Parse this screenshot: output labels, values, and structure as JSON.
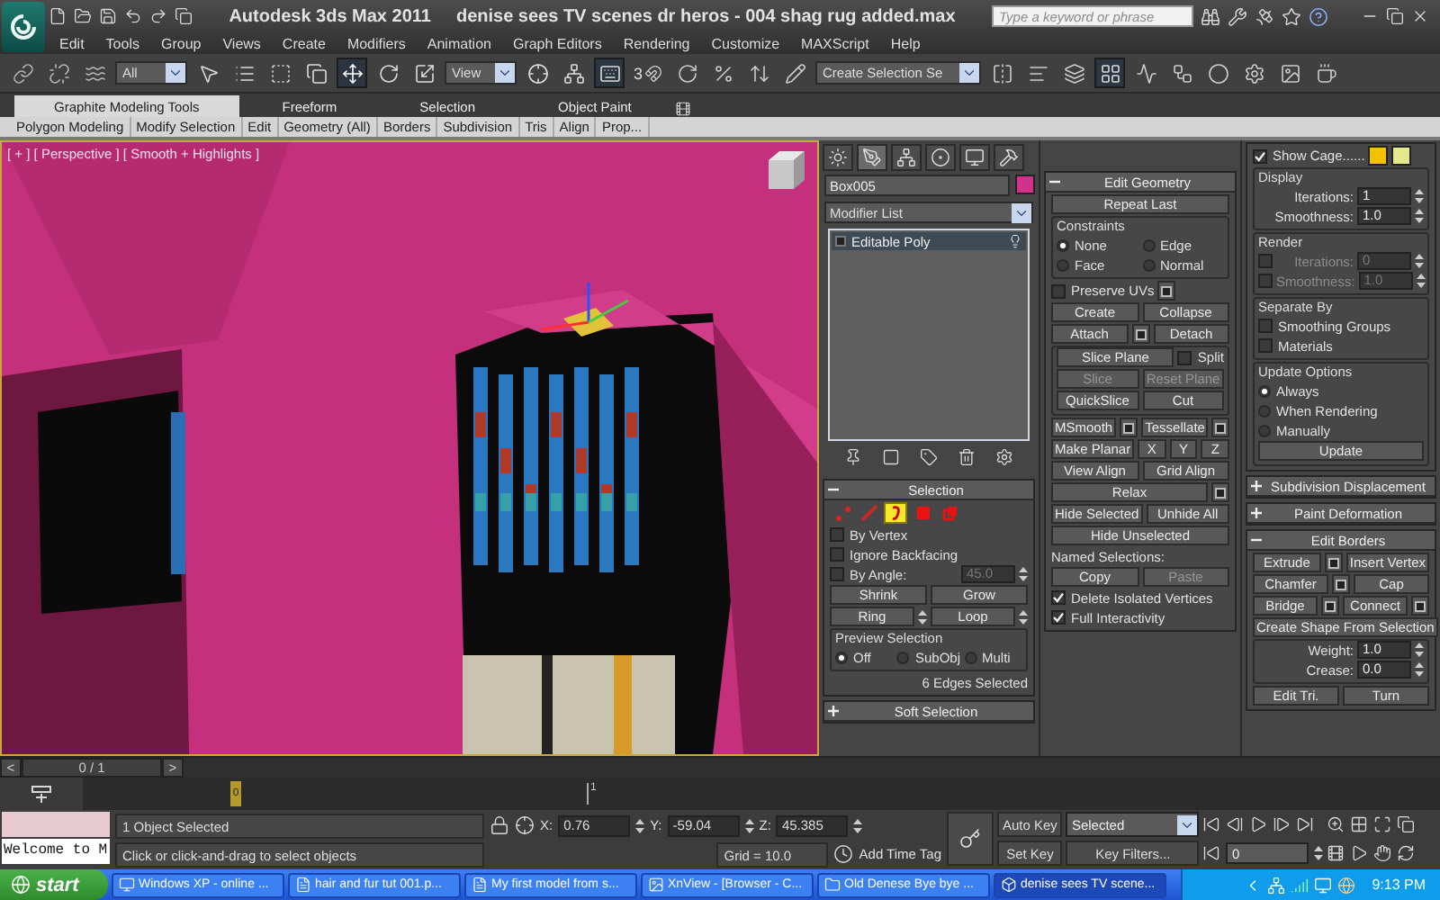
{
  "title_bar": {
    "app": "Autodesk 3ds Max  2011",
    "document": "denise sees TV scenes dr heros - 004 shag rug added.max",
    "search": {
      "placeholder": "Type a keyword or phrase"
    }
  },
  "menu": [
    "Edit",
    "Tools",
    "Group",
    "Views",
    "Create",
    "Modifiers",
    "Animation",
    "Graph Editors",
    "Rendering",
    "Customize",
    "MAXScript",
    "Help"
  ],
  "toolbar": {
    "items": [
      {
        "kind": "tool",
        "selected": false
      },
      {
        "kind": "tool",
        "selected": false
      },
      {
        "kind": "tool",
        "selected": false
      },
      {
        "kind": "dropdown",
        "value": "All"
      },
      {
        "kind": "tool",
        "selected": false
      },
      {
        "kind": "tool",
        "selected": false
      },
      {
        "kind": "tool",
        "selected": false
      },
      {
        "kind": "tool",
        "selected": false
      },
      {
        "kind": "tool",
        "selected": true
      },
      {
        "kind": "tool",
        "selected": false
      },
      {
        "kind": "tool",
        "selected": false
      },
      {
        "kind": "dropdown",
        "value": "View"
      },
      {
        "kind": "tool",
        "selected": false
      },
      {
        "kind": "tool",
        "selected": false
      },
      {
        "kind": "tool",
        "selected": true
      },
      {
        "kind": "snap",
        "value": "3"
      },
      {
        "kind": "tool",
        "selected": false
      },
      {
        "kind": "tool",
        "selected": false
      },
      {
        "kind": "tool",
        "selected": false
      },
      {
        "kind": "tool",
        "selected": false
      },
      {
        "kind": "dropdown",
        "value": "Create Selection Se"
      },
      {
        "kind": "tool",
        "selected": false
      },
      {
        "kind": "tool",
        "selected": false
      },
      {
        "kind": "tool",
        "selected": false
      },
      {
        "kind": "tool",
        "selected": true
      },
      {
        "kind": "tool",
        "selected": false
      },
      {
        "kind": "tool",
        "selected": false
      },
      {
        "kind": "tool",
        "selected": false
      },
      {
        "kind": "tool",
        "selected": false
      },
      {
        "kind": "tool",
        "selected": false
      },
      {
        "kind": "tool",
        "selected": false
      }
    ]
  },
  "ribbon": {
    "tabs": [
      {
        "label": "Graphite Modeling Tools",
        "selected": true
      },
      {
        "label": "Freeform",
        "selected": false
      },
      {
        "label": "Selection",
        "selected": false
      },
      {
        "label": "Object Paint",
        "selected": false
      }
    ],
    "panels": [
      "Polygon Modeling",
      "Modify Selection",
      "Edit",
      "Geometry (All)",
      "Borders",
      "Subdivision",
      "Tris",
      "Align",
      "Prop..."
    ]
  },
  "viewport": {
    "label": "[ + ] [ Perspective ] [ Smooth + Highlights ]"
  },
  "command_panel": {
    "tabs": [
      {
        "kind": "create",
        "selected": false
      },
      {
        "kind": "modify",
        "selected": true
      },
      {
        "kind": "hierarchy",
        "selected": false
      },
      {
        "kind": "motion",
        "selected": false
      },
      {
        "kind": "display",
        "selected": false
      },
      {
        "kind": "utilities",
        "selected": false
      }
    ],
    "object_name": "Box005",
    "modifier_list": "Modifier List",
    "stack": [
      {
        "label": "Editable Poly",
        "selected": true
      }
    ],
    "columns": [
      [
        {
          "title": "Selection",
          "expanded": true,
          "sections": [
            {
              "kind": "plain",
              "rows": [
                {
                  "items": [
                    {
                      "kind": "vertex",
                      "selected": false
                    },
                    {
                      "kind": "edge",
                      "selected": false
                    },
                    {
                      "kind": "border",
                      "selected": true
                    },
                    {
                      "kind": "polygon",
                      "selected": false
                    },
                    {
                      "kind": "element",
                      "selected": false
                    }
                  ]
                }
              ]
            },
            {
              "kind": "plain",
              "rows": [
                {
                  "items": [
                    {
                      "kind": "check",
                      "label": "By Vertex",
                      "checked": false
                    }
                  ]
                },
                {
                  "items": [
                    {
                      "kind": "check",
                      "label": "Ignore Backfacing",
                      "checked": false
                    }
                  ]
                },
                {
                  "items": [
                    {
                      "kind": "check",
                      "label": "By Angle:",
                      "checked": false
                    },
                    {
                      "kind": "spinner",
                      "value": "45.0",
                      "disabled": true
                    }
                  ]
                },
                {
                  "items": [
                    {
                      "kind": "button",
                      "label": "Shrink",
                      "disabled": false
                    },
                    {
                      "kind": "button",
                      "label": "Grow",
                      "disabled": false
                    }
                  ]
                },
                {
                  "items": [
                    {
                      "kind": "button",
                      "label": "Ring",
                      "disabled": false
                    },
                    {
                      "kind": "stepper"
                    },
                    {
                      "kind": "button",
                      "label": "Loop",
                      "disabled": false
                    },
                    {
                      "kind": "stepper"
                    }
                  ]
                }
              ]
            },
            {
              "kind": "group",
              "title": "Preview Selection",
              "rows": [
                {
                  "items": [
                    {
                      "kind": "radio",
                      "label": "Off",
                      "selected": true
                    },
                    {
                      "kind": "radio",
                      "label": "SubObj",
                      "selected": false
                    },
                    {
                      "kind": "radio",
                      "label": "Multi",
                      "selected": false
                    }
                  ]
                }
              ]
            },
            {
              "kind": "plain",
              "rows": [
                {
                  "items": [
                    {
                      "kind": "status",
                      "text": "6 Edges Selected"
                    }
                  ]
                }
              ]
            }
          ]
        },
        {
          "title": "Soft Selection",
          "expanded": false
        }
      ],
      [
        {
          "title": "Edit Geometry",
          "expanded": true,
          "sections": [
            {
              "kind": "plain",
              "rows": [
                {
                  "items": [
                    {
                      "kind": "button",
                      "label": "Repeat Last",
                      "disabled": false
                    }
                  ]
                }
              ]
            },
            {
              "kind": "group",
              "title": "Constraints",
              "rows": [
                {
                  "items": [
                    {
                      "kind": "radio",
                      "label": "None",
                      "selected": true
                    },
                    {
                      "kind": "radio",
                      "label": "Edge",
                      "selected": false
                    }
                  ]
                },
                {
                  "items": [
                    {
                      "kind": "radio",
                      "label": "Face",
                      "selected": false
                    },
                    {
                      "kind": "radio",
                      "label": "Normal",
                      "selected": false
                    }
                  ]
                }
              ]
            },
            {
              "kind": "plain",
              "rows": [
                {
                  "items": [
                    {
                      "kind": "check",
                      "label": "Preserve UVs",
                      "checked": false
                    },
                    {
                      "kind": "settings"
                    }
                  ]
                },
                {
                  "items": [
                    {
                      "kind": "button",
                      "label": "Create",
                      "disabled": false
                    },
                    {
                      "kind": "button",
                      "label": "Collapse",
                      "disabled": false
                    }
                  ]
                },
                {
                  "items": [
                    {
                      "kind": "button",
                      "label": "Attach",
                      "disabled": false
                    },
                    {
                      "kind": "settings"
                    },
                    {
                      "kind": "button",
                      "label": "Detach",
                      "disabled": false
                    }
                  ]
                }
              ]
            },
            {
              "kind": "group",
              "rows": [
                {
                  "items": [
                    {
                      "kind": "button",
                      "label": "Slice Plane",
                      "disabled": false
                    },
                    {
                      "kind": "check",
                      "label": "Split",
                      "checked": false
                    }
                  ]
                },
                {
                  "items": [
                    {
                      "kind": "button",
                      "label": "Slice",
                      "disabled": true
                    },
                    {
                      "kind": "button",
                      "label": "Reset Plane",
                      "disabled": true
                    }
                  ]
                },
                {
                  "items": [
                    {
                      "kind": "button",
                      "label": "QuickSlice",
                      "disabled": false
                    },
                    {
                      "kind": "button",
                      "label": "Cut",
                      "disabled": false
                    }
                  ]
                }
              ]
            },
            {
              "kind": "plain",
              "rows": [
                {
                  "items": [
                    {
                      "kind": "button",
                      "label": "MSmooth",
                      "disabled": false
                    },
                    {
                      "kind": "settings"
                    },
                    {
                      "kind": "button",
                      "label": "Tessellate",
                      "disabled": false
                    },
                    {
                      "kind": "settings"
                    }
                  ]
                },
                {
                  "items": [
                    {
                      "kind": "button",
                      "label": "Make Planar",
                      "disabled": false
                    },
                    {
                      "kind": "button",
                      "label": "X",
                      "disabled": false
                    },
                    {
                      "kind": "button",
                      "label": "Y",
                      "disabled": false
                    },
                    {
                      "kind": "button",
                      "label": "Z",
                      "disabled": false
                    }
                  ]
                },
                {
                  "items": [
                    {
                      "kind": "button",
                      "label": "View Align",
                      "disabled": false
                    },
                    {
                      "kind": "button",
                      "label": "Grid Align",
                      "disabled": false
                    }
                  ]
                },
                {
                  "items": [
                    {
                      "kind": "button",
                      "label": "Relax",
                      "disabled": false
                    },
                    {
                      "kind": "settings"
                    }
                  ]
                },
                {
                  "items": [
                    {
                      "kind": "button",
                      "label": "Hide Selected",
                      "disabled": false
                    },
                    {
                      "kind": "button",
                      "label": "Unhide All",
                      "disabled": false
                    }
                  ]
                },
                {
                  "items": [
                    {
                      "kind": "button",
                      "label": "Hide Unselected",
                      "disabled": false
                    }
                  ]
                },
                {
                  "items": [
                    {
                      "kind": "text",
                      "text": "Named Selections:"
                    }
                  ]
                },
                {
                  "items": [
                    {
                      "kind": "button",
                      "label": "Copy",
                      "disabled": false
                    },
                    {
                      "kind": "button",
                      "label": "Paste",
                      "disabled": true
                    }
                  ]
                },
                {
                  "items": [
                    {
                      "kind": "check",
                      "label": "Delete Isolated Vertices",
                      "checked": true
                    }
                  ]
                },
                {
                  "items": [
                    {
                      "kind": "check",
                      "label": "Full Interactivity",
                      "checked": true
                    }
                  ]
                }
              ]
            }
          ]
        }
      ],
      [
        {
          "sections": [
            {
              "kind": "plain",
              "rows": [
                {
                  "items": [
                    {
                      "kind": "check",
                      "label": "Show Cage......",
                      "checked": true
                    },
                    {
                      "kind": "swatch",
                      "color": "#f2c200"
                    },
                    {
                      "kind": "swatch",
                      "color": "#e6e88c"
                    }
                  ]
                }
              ]
            },
            {
              "kind": "group",
              "title": "Display",
              "rows": [
                {
                  "items": [
                    {
                      "kind": "spinner",
                      "label": "Iterations:",
                      "value": "1",
                      "disabled": false
                    }
                  ]
                },
                {
                  "items": [
                    {
                      "kind": "spinner",
                      "label": "Smoothness:",
                      "value": "1.0",
                      "disabled": false
                    }
                  ]
                }
              ]
            },
            {
              "kind": "group",
              "title": "Render",
              "rows": [
                {
                  "items": [
                    {
                      "kind": "check",
                      "checked": false
                    },
                    {
                      "kind": "spinner",
                      "label": "Iterations:",
                      "value": "0",
                      "disabled": true
                    }
                  ]
                },
                {
                  "items": [
                    {
                      "kind": "check",
                      "checked": false
                    },
                    {
                      "kind": "spinner",
                      "label": "Smoothness:",
                      "value": "1.0",
                      "disabled": true
                    }
                  ]
                }
              ]
            },
            {
              "kind": "group",
              "title": "Separate By",
              "rows": [
                {
                  "items": [
                    {
                      "kind": "check",
                      "label": "Smoothing Groups",
                      "checked": false
                    }
                  ]
                },
                {
                  "items": [
                    {
                      "kind": "check",
                      "label": "Materials",
                      "checked": false
                    }
                  ]
                }
              ]
            },
            {
              "kind": "group",
              "title": "Update Options",
              "rows": [
                {
                  "items": [
                    {
                      "kind": "radio",
                      "label": "Always",
                      "selected": true
                    }
                  ]
                },
                {
                  "items": [
                    {
                      "kind": "radio",
                      "label": "When Rendering",
                      "selected": false
                    }
                  ]
                },
                {
                  "items": [
                    {
                      "kind": "radio",
                      "label": "Manually",
                      "selected": false
                    }
                  ]
                },
                {
                  "items": [
                    {
                      "kind": "button",
                      "label": "Update",
                      "disabled": false
                    }
                  ]
                }
              ]
            }
          ]
        },
        {
          "title": "Subdivision Displacement",
          "expanded": false
        },
        {
          "title": "Paint Deformation",
          "expanded": false
        },
        {
          "title": "Edit Borders",
          "expanded": true,
          "sections": [
            {
              "kind": "plain",
              "rows": [
                {
                  "items": [
                    {
                      "kind": "button",
                      "label": "Extrude",
                      "disabled": false
                    },
                    {
                      "kind": "settings"
                    },
                    {
                      "kind": "button",
                      "label": "Insert Vertex",
                      "disabled": false
                    }
                  ]
                },
                {
                  "items": [
                    {
                      "kind": "button",
                      "label": "Chamfer",
                      "disabled": false
                    },
                    {
                      "kind": "settings"
                    },
                    {
                      "kind": "button",
                      "label": "Cap",
                      "disabled": false
                    }
                  ]
                },
                {
                  "items": [
                    {
                      "kind": "button",
                      "label": "Bridge",
                      "disabled": false
                    },
                    {
                      "kind": "settings"
                    },
                    {
                      "kind": "button",
                      "label": "Connect",
                      "disabled": false
                    },
                    {
                      "kind": "settings"
                    }
                  ]
                },
                {
                  "items": [
                    {
                      "kind": "button",
                      "label": "Create Shape From Selection",
                      "disabled": false
                    }
                  ]
                }
              ]
            },
            {
              "kind": "group",
              "rows": [
                {
                  "items": [
                    {
                      "kind": "spinner",
                      "label": "Weight:",
                      "value": "1.0",
                      "disabled": false
                    }
                  ]
                },
                {
                  "items": [
                    {
                      "kind": "spinner",
                      "label": "Crease:",
                      "value": "0.0",
                      "disabled": false
                    }
                  ]
                }
              ]
            },
            {
              "kind": "plain",
              "rows": [
                {
                  "items": [
                    {
                      "kind": "button",
                      "label": "Edit Tri.",
                      "disabled": false
                    },
                    {
                      "kind": "button",
                      "label": "Turn",
                      "disabled": false
                    }
                  ]
                }
              ]
            }
          ]
        }
      ]
    ]
  },
  "time_slider": {
    "prev": "<",
    "position": "0 / 1",
    "next": ">"
  },
  "trackbar": {
    "ticks": [
      "0",
      "1"
    ]
  },
  "listener": {
    "text": "Welcome to M"
  },
  "status": {
    "selection": "1 Object Selected",
    "prompt": "Click or click-and-drag to select objects"
  },
  "coords": [
    {
      "axis": "X:",
      "value": "0.76"
    },
    {
      "axis": "Y:",
      "value": "-59.04"
    },
    {
      "axis": "Z:",
      "value": "45.385"
    }
  ],
  "grid": "Grid = 10.0",
  "time_tag": "Add Time Tag",
  "keys": {
    "auto_key": "Auto Key",
    "set_key": "Set Key",
    "key_mode": "Selected",
    "key_filters": "Key Filters...",
    "frame": "0"
  },
  "taskbar": {
    "start": "start",
    "tasks": [
      {
        "kind": "system",
        "label": "Windows XP - online ...",
        "selected": false
      },
      {
        "kind": "pdf",
        "label": "hair and fur tut 001.p...",
        "selected": false
      },
      {
        "kind": "pdf",
        "label": "My first model from s...",
        "selected": false
      },
      {
        "kind": "viewer",
        "label": "XnView - [Browser - C...",
        "selected": false
      },
      {
        "kind": "folder",
        "label": "Old Denese Bye bye ...",
        "selected": false
      },
      {
        "kind": "max",
        "label": "denise sees TV scene...",
        "selected": true
      }
    ],
    "clock": "9:13 PM"
  }
}
